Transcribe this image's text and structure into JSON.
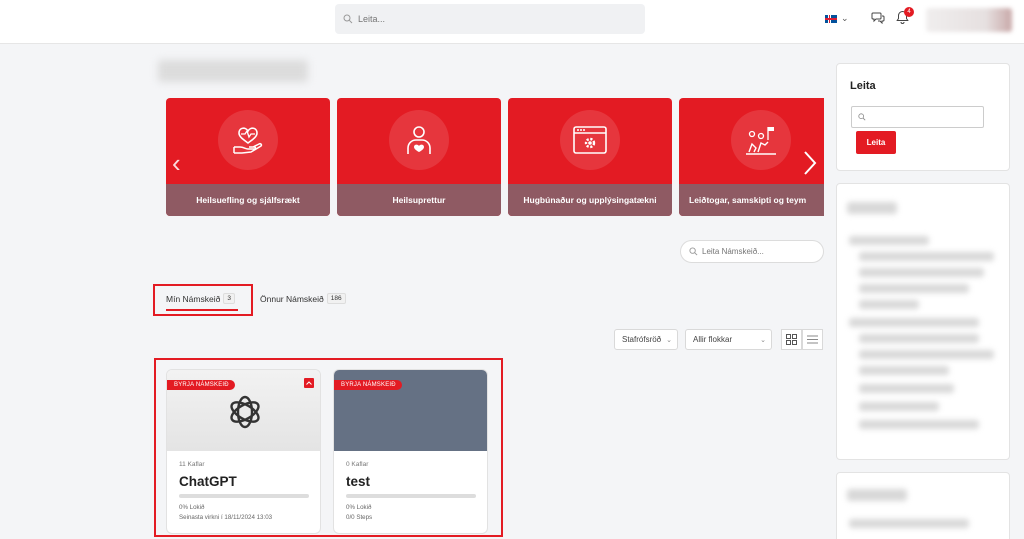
{
  "topbar": {
    "search_placeholder": "Leita...",
    "notification_count": "4",
    "flag": "iceland-flag-icon"
  },
  "categories": [
    {
      "label": "Heilsuefling og sjálfsrækt",
      "icon": "heart-hand-icon"
    },
    {
      "label": "Heilsuprettur",
      "icon": "person-heart-icon"
    },
    {
      "label": "Hugbúnaður og upplýsingatækni",
      "icon": "browser-gear-icon"
    },
    {
      "label": "Leiðtogar, samskipti og teym",
      "icon": "team-flag-icon"
    }
  ],
  "course_search": {
    "placeholder": "Leita Námskeið..."
  },
  "tabs": [
    {
      "label": "Mín Námskeið",
      "count": "3"
    },
    {
      "label": "Önnur Námskeið",
      "count": "186"
    }
  ],
  "filters": {
    "sort": "Stafrófsröð",
    "category": "Allir flokkar"
  },
  "courses": [
    {
      "badge": "BYRJA NÁMSKEIÐ",
      "chapters": "11 Kaflar",
      "title": "ChatGPT",
      "progress_pct": 0,
      "done_text": "0% Lokið",
      "last_activity": "Seinasta virkni í 18/11/2024 13:03"
    },
    {
      "badge": "BYRJA NÁMSKEIÐ",
      "chapters": "0 Kaflar",
      "title": "test",
      "progress_pct": 0,
      "done_text": "0% Lokið",
      "last_activity": "0/0 Steps"
    }
  ],
  "sidebar": {
    "search_title": "Leita",
    "search_button": "Leita"
  },
  "colors": {
    "accent": "#e31b23",
    "category_label_bg": "#8f5a63",
    "test_thumb": "#657184"
  }
}
